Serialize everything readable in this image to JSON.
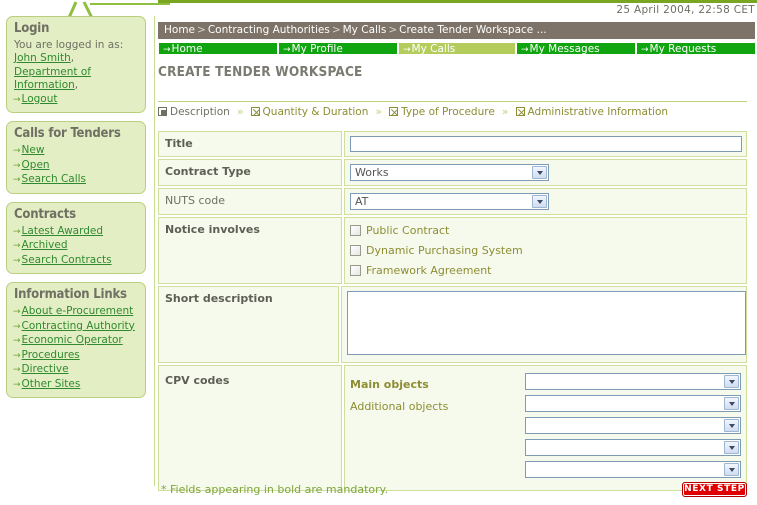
{
  "timestamp": "25 April 2004, 22:58 CET",
  "breadcrumb": {
    "items": [
      "Home",
      "Contracting Authorities",
      "My Calls",
      "Create Tender Workspace ..."
    ],
    "separator": ">"
  },
  "nav_tabs": [
    {
      "label": "Home",
      "active": false
    },
    {
      "label": "My Profile",
      "active": false
    },
    {
      "label": "My Calls",
      "active": true
    },
    {
      "label": "My Messages",
      "active": false
    },
    {
      "label": "My Requests",
      "active": false
    }
  ],
  "page_title": "CREATE TENDER WORKSPACE",
  "steps": [
    {
      "label": "Description",
      "icon": "filled-square-icon",
      "current": true
    },
    {
      "label": "Quantity & Duration",
      "icon": "x-box-icon",
      "current": false
    },
    {
      "label": "Type of Procedure",
      "icon": "x-box-icon",
      "current": false
    },
    {
      "label": "Administrative Information",
      "icon": "x-box-icon",
      "current": false
    }
  ],
  "step_separator": "»",
  "sidebar": {
    "login": {
      "title": "Login",
      "intro": "You are logged in as:",
      "user_name": "John Smith",
      "comma1": ",",
      "organisation": "Department of Information",
      "comma2": ",",
      "logout": "Logout"
    },
    "calls": {
      "title": "Calls for Tenders",
      "items": [
        "New",
        "Open",
        "Search Calls"
      ]
    },
    "contracts": {
      "title": "Contracts",
      "items": [
        "Latest Awarded",
        "Archived",
        "Search Contracts"
      ]
    },
    "info": {
      "title": "Information Links",
      "items": [
        "About e-Procurement",
        "Contracting Authority",
        "Economic Operator",
        "Procedures",
        "Directive",
        "Other Sites"
      ]
    }
  },
  "form": {
    "title": {
      "label": "Title",
      "value": "",
      "placeholder": ""
    },
    "contract_type": {
      "label": "Contract Type",
      "value": "Works"
    },
    "nuts_code": {
      "label": "NUTS code",
      "value": "AT"
    },
    "notice_involves": {
      "label": "Notice involves",
      "options": [
        {
          "label": "Public Contract",
          "checked": false
        },
        {
          "label": "Dynamic Purchasing System",
          "checked": false
        },
        {
          "label": "Framework Agreement",
          "checked": false
        }
      ]
    },
    "short_description": {
      "label": "Short description",
      "value": "",
      "placeholder": ""
    },
    "cpv": {
      "label": "CPV codes",
      "main_objects_label": "Main objects",
      "additional_objects_label": "Additional objects",
      "main_value": "",
      "additional_values": [
        "",
        "",
        "",
        ""
      ]
    }
  },
  "footnote": "* Fields appearing in bold are mandatory.",
  "next_button": "NEXT STEP",
  "colors": {
    "brand_green": "#79a521",
    "tab_green": "#10a510",
    "tab_active": "#b3cc5c",
    "breadcrumb_bg": "#7d7368",
    "panel_bg": "#e4eec4",
    "panel_border": "#b9cf7e",
    "field_bg": "#f6faec",
    "field_border": "#cfe09d",
    "link_green": "#2f8a2f",
    "olive_text": "#8d8d33",
    "button_red": "#e00000"
  }
}
